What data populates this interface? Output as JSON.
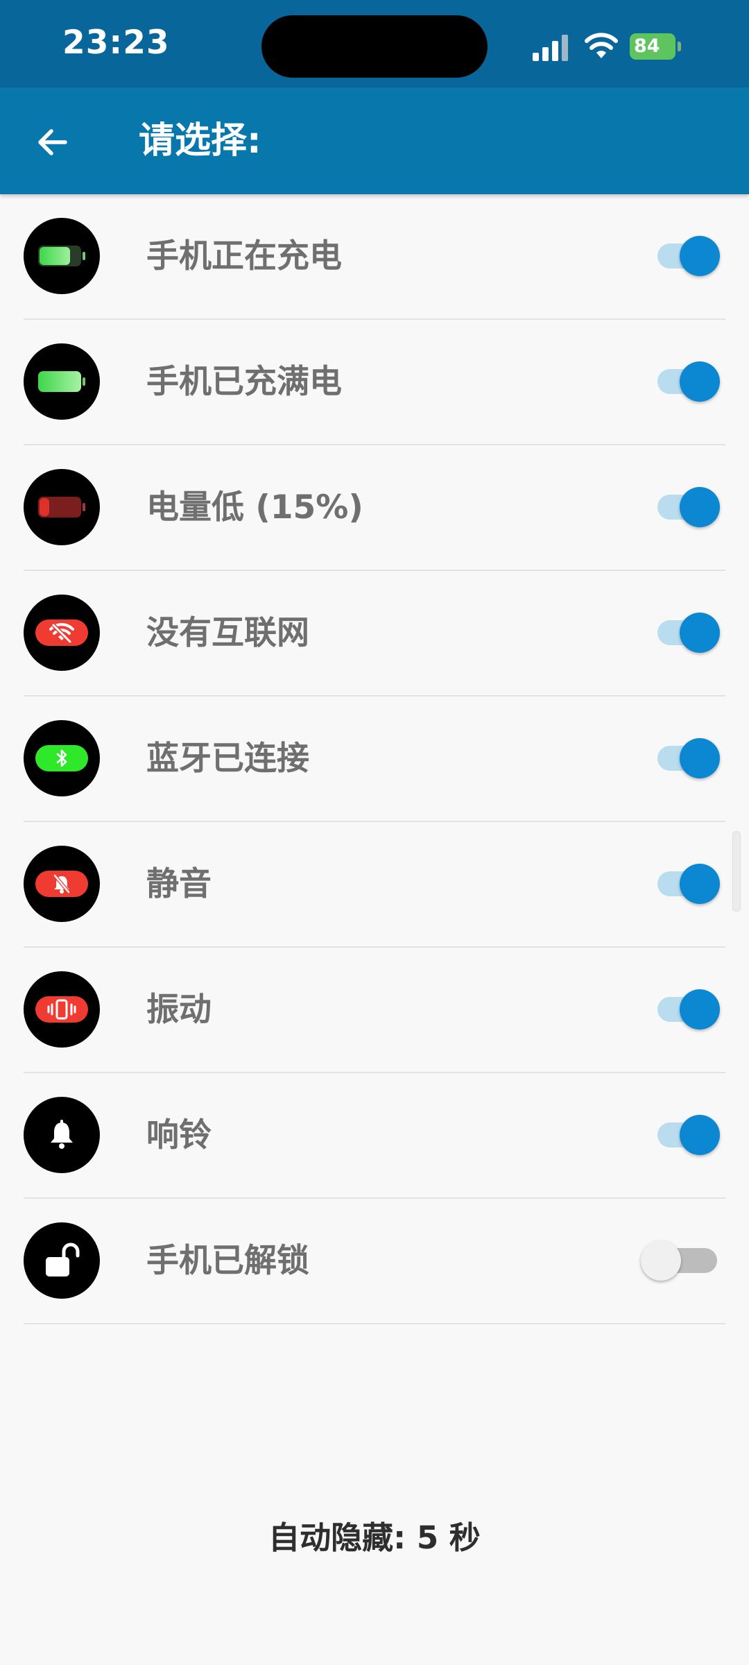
{
  "status_bar": {
    "time": "23:23",
    "battery_level": "84",
    "signal_icon": "cellular-signal-icon",
    "wifi_icon": "wifi-icon"
  },
  "app_bar": {
    "back_icon": "arrow-left-icon",
    "title": "请选择:"
  },
  "colors": {
    "status_bar": "#08669a",
    "app_bar": "#0878ac",
    "toggle_on_thumb": "#0c87d2",
    "toggle_on_track": "#b9dcef",
    "toggle_off_thumb": "#f0f0f0",
    "toggle_off_track": "#bcbcbc",
    "label_text": "#6f6f6f"
  },
  "items": [
    {
      "label": "手机正在充电",
      "icon": "battery-charging-icon",
      "enabled": true
    },
    {
      "label": "手机已充满电",
      "icon": "battery-full-icon",
      "enabled": true
    },
    {
      "label": "电量低 (15%)",
      "icon": "battery-low-icon",
      "enabled": true
    },
    {
      "label": "没有互联网",
      "icon": "no-internet-icon",
      "enabled": true
    },
    {
      "label": "蓝牙已连接",
      "icon": "bluetooth-icon",
      "enabled": true
    },
    {
      "label": "静音",
      "icon": "silent-bell-icon",
      "enabled": true
    },
    {
      "label": "振动",
      "icon": "vibrate-icon",
      "enabled": true
    },
    {
      "label": "响铃",
      "icon": "bell-icon",
      "enabled": true
    },
    {
      "label": "手机已解锁",
      "icon": "unlock-icon",
      "enabled": false
    }
  ],
  "footer": {
    "auto_hide": "自动隐藏: 5 秒"
  }
}
